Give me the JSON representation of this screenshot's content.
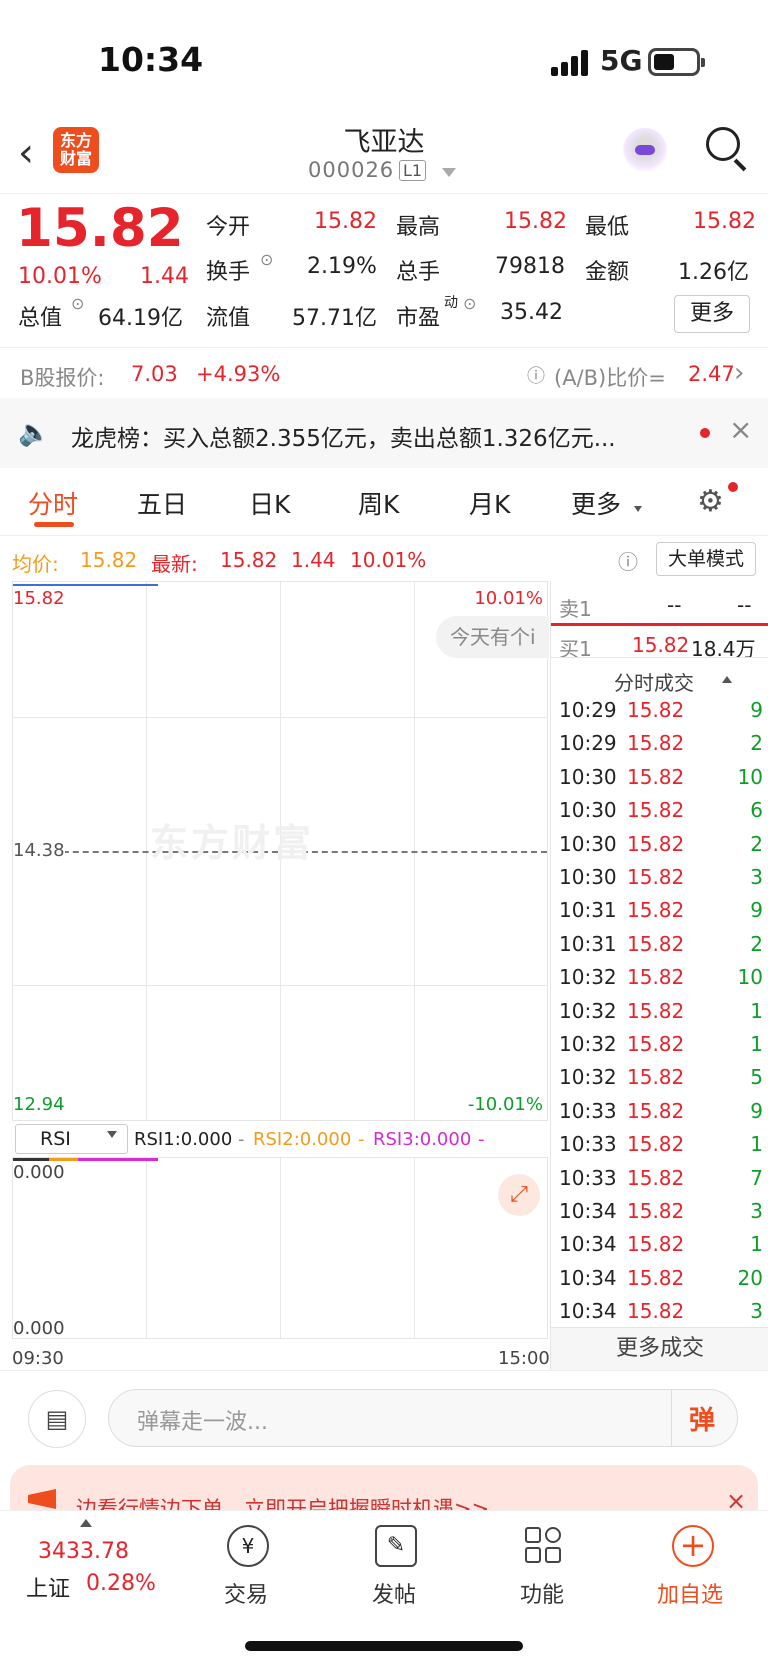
{
  "status": {
    "time": "10:34",
    "network": "5G"
  },
  "nav": {
    "title": "飞亚达",
    "code": "000026",
    "level": "L1",
    "logo": "东方\n财富"
  },
  "quote": {
    "price": "15.82",
    "pct": "10.01%",
    "change": "1.44",
    "rows": [
      [
        {
          "l": "今开",
          "v": "15.82",
          "red": true
        },
        {
          "l": "最高",
          "v": "15.82",
          "red": true
        },
        {
          "l": "最低",
          "v": "15.82",
          "red": true
        }
      ],
      [
        {
          "l": "换手",
          "v": "2.19%"
        },
        {
          "l": "总手",
          "v": "79818"
        },
        {
          "l": "金额",
          "v": "1.26亿"
        }
      ]
    ],
    "total_mv_label": "总值",
    "total_mv": "64.19亿",
    "float_mv_label": "流值",
    "float_mv": "57.71亿",
    "pe_label": "市盈",
    "pe_sup": "动",
    "pe": "35.42",
    "more": "更多"
  },
  "bshare": {
    "label": "B股报价:",
    "price": "7.03",
    "pct": "+4.93%",
    "ratio_label": "(A/B)比价=",
    "ratio": "2.47"
  },
  "banner": {
    "text": "龙虎榜：买入总额2.355亿元，卖出总额1.326亿元..."
  },
  "tabs": [
    "分时",
    "五日",
    "日K",
    "周K",
    "月K",
    "更多"
  ],
  "info": {
    "avg_label": "均价:",
    "avg": "15.82",
    "latest_label": "最新:",
    "latest": "15.82",
    "chg": "1.44",
    "pct": "10.01%",
    "mode": "大单模式"
  },
  "chart": {
    "high": "15.82",
    "high_pct": "10.01%",
    "mid": "14.38",
    "low": "12.94",
    "low_pct": "-10.01%",
    "tip": "今天有个i",
    "watermark": "东方财富",
    "start": "09:30",
    "end": "15:00"
  },
  "rsi": {
    "select": "RSI",
    "rsi1": "RSI1:0.000",
    "rsi2": "RSI2:0.000",
    "rsi3": "RSI3:0.000",
    "top": "0.000",
    "bottom": "0.000",
    "dash": "-"
  },
  "book": {
    "sell_label": "卖1",
    "sell_p": "--",
    "sell_v": "--",
    "buy_label": "买1",
    "buy_p": "15.82",
    "buy_v": "18.4万",
    "detail_title": "分时成交",
    "more": "更多成交"
  },
  "trades": [
    [
      "10:29",
      "15.82",
      "9"
    ],
    [
      "10:29",
      "15.82",
      "2"
    ],
    [
      "10:30",
      "15.82",
      "10"
    ],
    [
      "10:30",
      "15.82",
      "6"
    ],
    [
      "10:30",
      "15.82",
      "2"
    ],
    [
      "10:30",
      "15.82",
      "3"
    ],
    [
      "10:31",
      "15.82",
      "9"
    ],
    [
      "10:31",
      "15.82",
      "2"
    ],
    [
      "10:32",
      "15.82",
      "10"
    ],
    [
      "10:32",
      "15.82",
      "1"
    ],
    [
      "10:32",
      "15.82",
      "1"
    ],
    [
      "10:32",
      "15.82",
      "5"
    ],
    [
      "10:33",
      "15.82",
      "9"
    ],
    [
      "10:33",
      "15.82",
      "1"
    ],
    [
      "10:33",
      "15.82",
      "7"
    ],
    [
      "10:34",
      "15.82",
      "3"
    ],
    [
      "10:34",
      "15.82",
      "1"
    ],
    [
      "10:34",
      "15.82",
      "20"
    ],
    [
      "10:34",
      "15.82",
      "3"
    ]
  ],
  "danmu": {
    "placeholder": "弹幕走一波...",
    "send": "弹"
  },
  "promo": {
    "text": "边看行情边下单，立即开启把握瞬时机遇>>"
  },
  "bottom": {
    "index_value": "3433.78",
    "index_name": "上证",
    "index_pct": "0.28%",
    "items": [
      "交易",
      "发帖",
      "功能",
      "加自选"
    ]
  }
}
